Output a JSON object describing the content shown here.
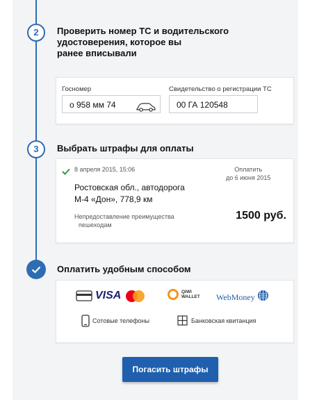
{
  "steps": [
    {
      "number": "2",
      "title_line1": "Проверить номер ТС и водительского",
      "title_line2": "удостоверения, которое вы",
      "title_line3": "ранее вписывали"
    },
    {
      "number": "3",
      "title": "Выбрать штрафы для оплаты"
    },
    {
      "title": "Оплатить удобным способом"
    }
  ],
  "vehicle": {
    "plate_label": "Госномер",
    "plate_value": "о 958 мм 74",
    "registration_label": "Свидетельство о регистрации ТС",
    "registration_value": "00 ГА 120548"
  },
  "fine": {
    "date": "8 апреля 2015, 15:06",
    "pay_until_line1": "Оплатить",
    "pay_until_line2": "до 6 июня 2015",
    "location_line1": "Ростовская обл., автодорога",
    "location_line2": "М-4 «Дон», 778,9 км",
    "violation_line1": "Непредоставление преимущества",
    "violation_line2": "пешеходам",
    "amount": "1500 руб."
  },
  "payment": {
    "visa": "VISA",
    "mastercard": "MasterCard",
    "qiwi_line1": "QIWI",
    "qiwi_line2": "WALLET",
    "webmoney": "WebMoney",
    "phones": "Сотовые телефоны",
    "bank": "Банковская квитанция"
  },
  "pay_button": "Погасить штрафы",
  "colors": {
    "accent": "#2c6db3",
    "button": "#1f5fae",
    "check_green": "#2e9a3a",
    "mastercard_red": "#eb001b",
    "mastercard_orange": "#f79e1b",
    "qiwi_orange": "#f7931e",
    "webmoney_blue": "#1f5fae",
    "visa_blue": "#1a1f71"
  }
}
